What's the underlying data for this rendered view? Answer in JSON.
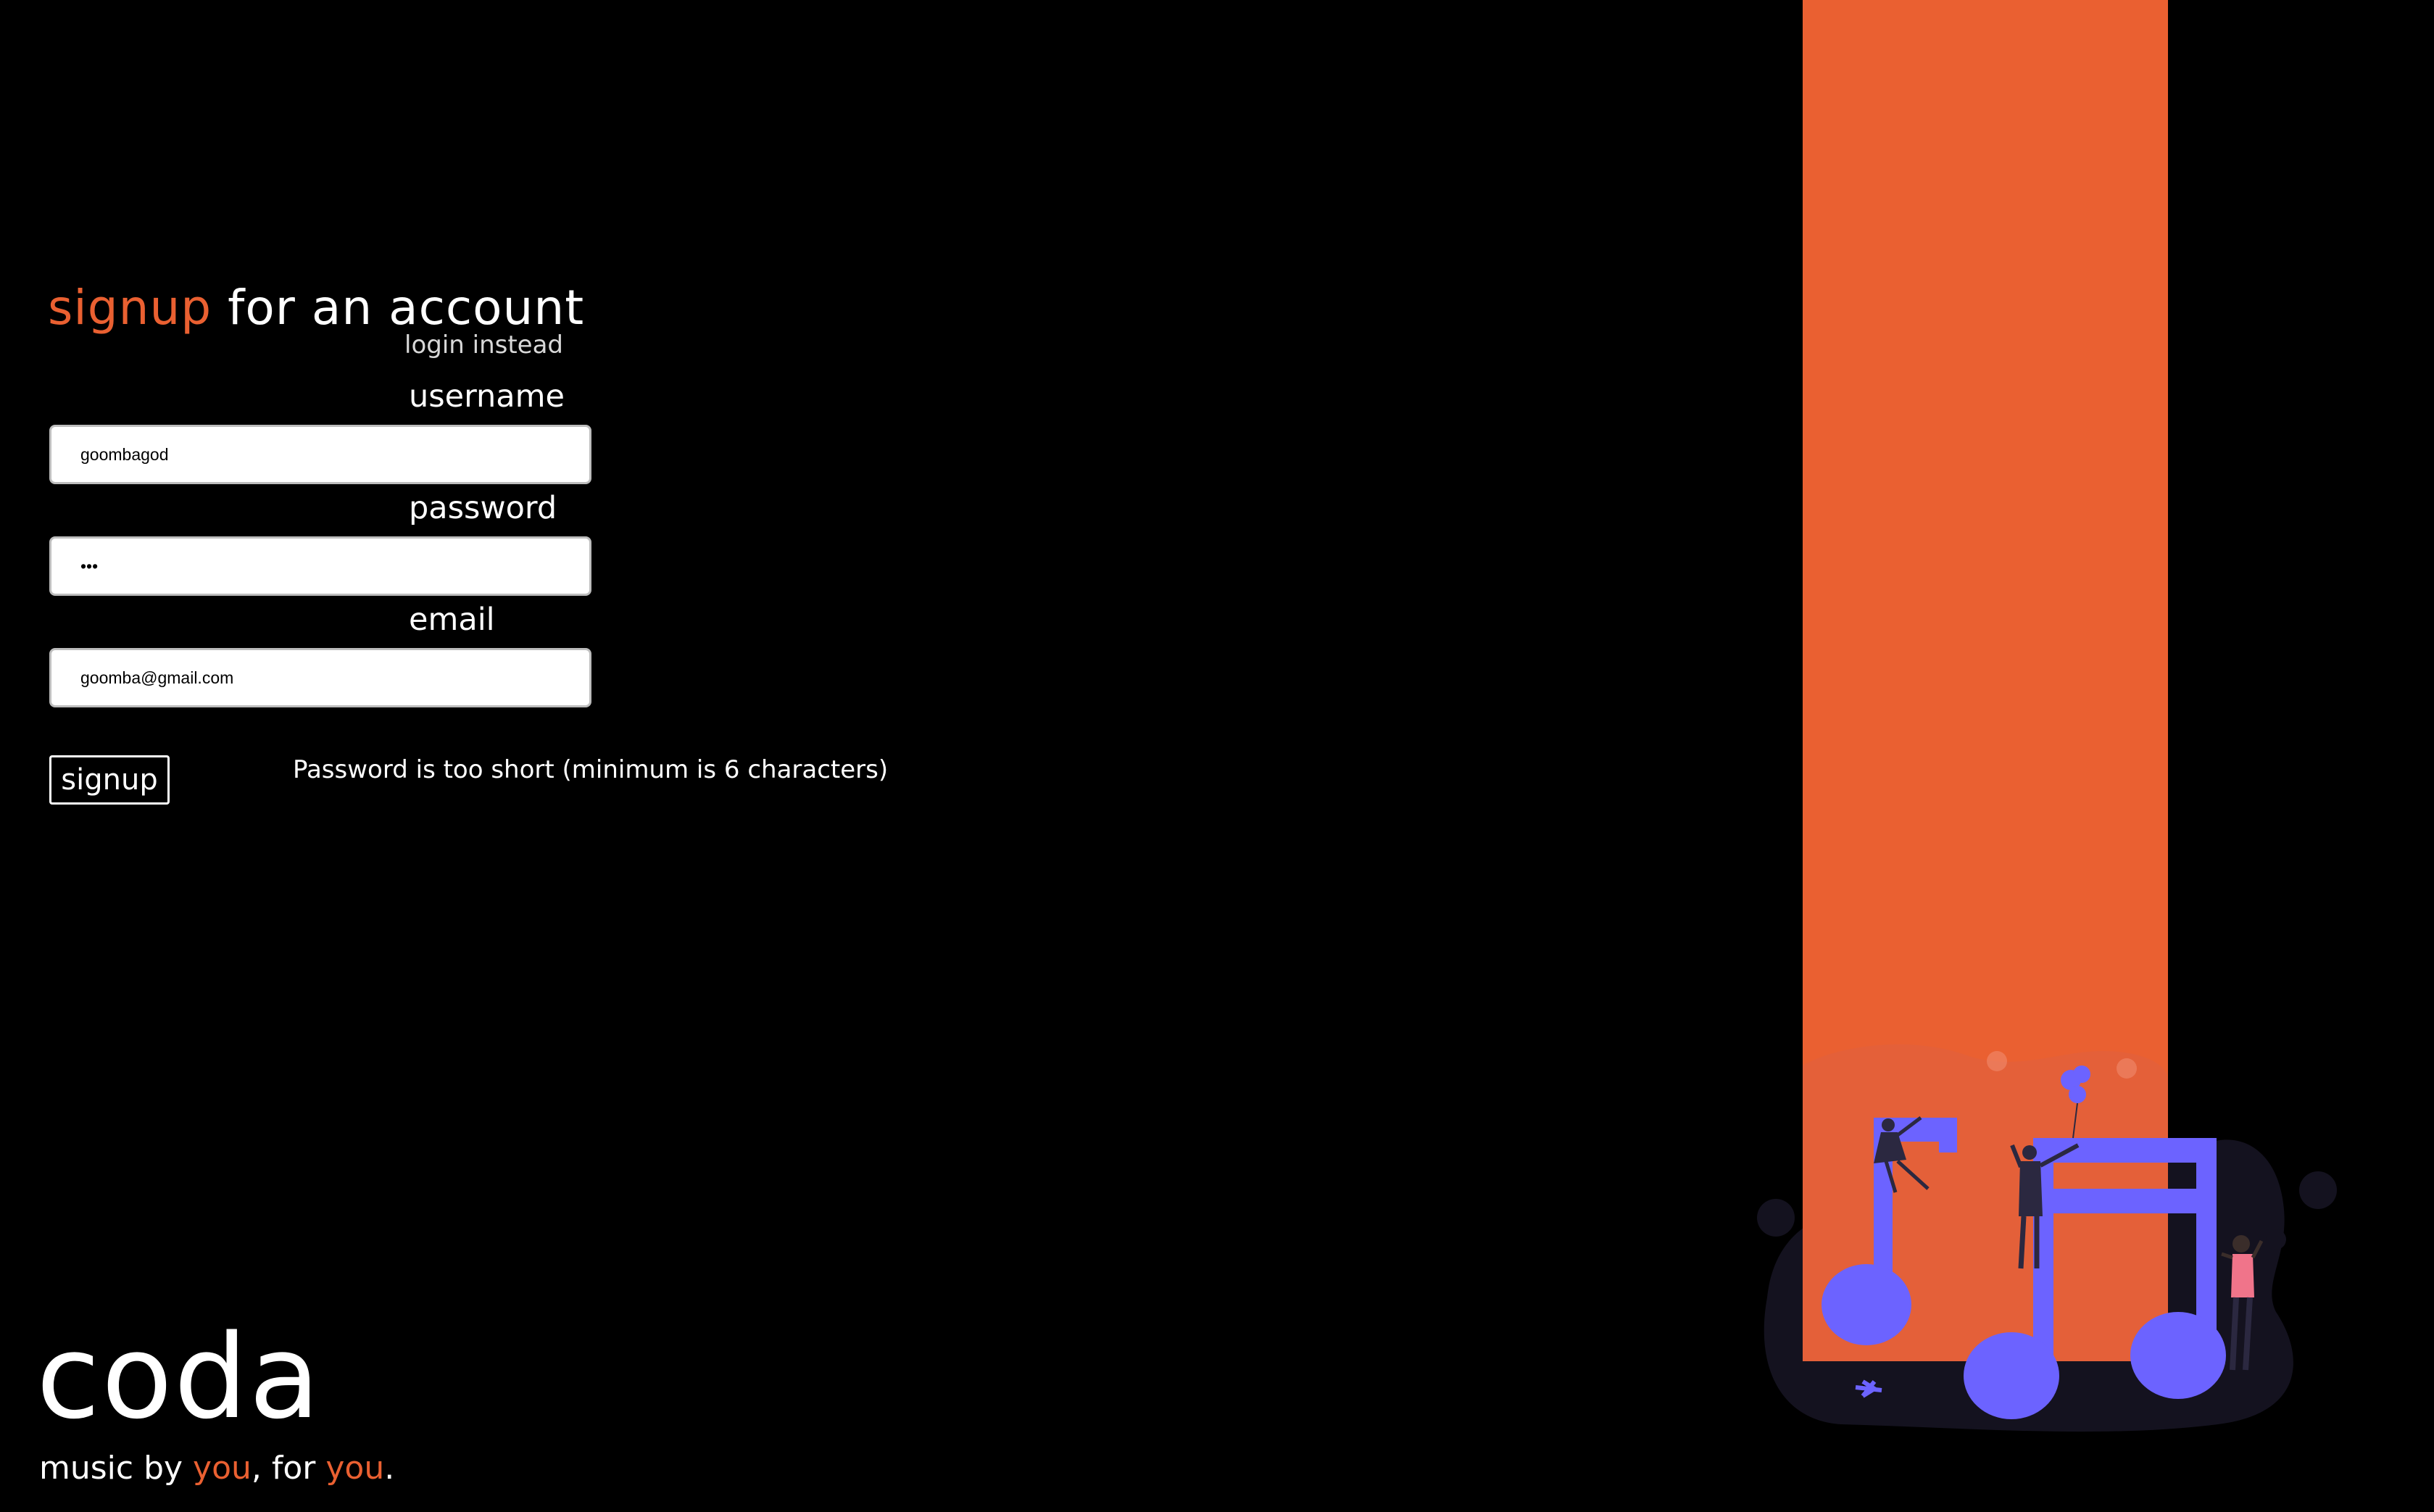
{
  "header": {
    "title_accent": "signup",
    "title_rest": " for an account",
    "login_link": "login instead"
  },
  "form": {
    "username_label": "username",
    "username_value": "goombagod",
    "password_label": "password",
    "password_value": "•••",
    "email_label": "email",
    "email_value": "goomba@gmail.com",
    "submit_label": "signup",
    "error_message": "Password is too short (minimum is 6 characters)"
  },
  "brand": {
    "logo": "coda",
    "tagline_part1": "music by ",
    "tagline_you1": "you",
    "tagline_part2": ", for ",
    "tagline_you2": "you",
    "tagline_end": "."
  },
  "illustration": {
    "icon": "music-notes-people-illustration"
  },
  "colors": {
    "background": "#000000",
    "accent": "#ea6031",
    "note_purple": "#6c63ff",
    "text": "#ffffff"
  }
}
